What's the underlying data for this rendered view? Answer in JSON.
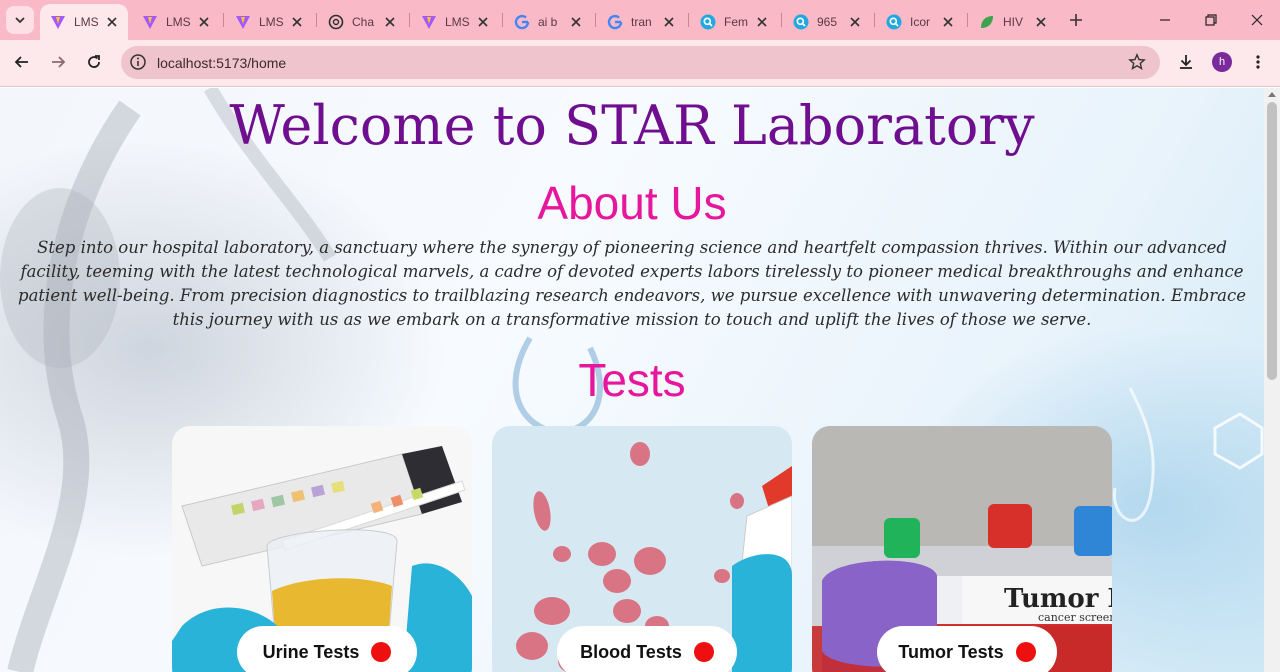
{
  "browser": {
    "tabs": [
      {
        "label": "LMS",
        "icon": "vite-icon",
        "active": true
      },
      {
        "label": "LMS",
        "icon": "vite-icon"
      },
      {
        "label": "LMS",
        "icon": "vite-icon"
      },
      {
        "label": "Cha",
        "icon": "chatgpt-icon"
      },
      {
        "label": "LMS",
        "icon": "vite-icon"
      },
      {
        "label": "ai b",
        "icon": "google-icon"
      },
      {
        "label": "tran",
        "icon": "google-icon"
      },
      {
        "label": "Fem",
        "icon": "search-bubble-icon"
      },
      {
        "label": "965",
        "icon": "search-bubble-icon"
      },
      {
        "label": "Icor",
        "icon": "search-bubble-icon"
      },
      {
        "label": "HIV",
        "icon": "leaf-icon"
      }
    ],
    "url": "localhost:5173/home",
    "profile_initial": "h"
  },
  "page": {
    "title": "Welcome to STAR Laboratory",
    "about_heading": "About Us",
    "about_text": "Step into our hospital laboratory, a sanctuary where the synergy of pioneering science and heartfelt compassion thrives. Within our advanced facility, teeming with the latest technological marvels, a cadre of devoted experts labors tirelessly to pioneer medical breakthroughs and enhance patient well-being. From precision diagnostics to trailblazing research endeavors, we pursue excellence with unwavering determination. Embrace this journey with us as we embark on a transformative mission to touch and uplift the lives of those we serve.",
    "tests_heading": "Tests",
    "cards": [
      {
        "label": "Urine Tests"
      },
      {
        "label": "Blood Tests"
      },
      {
        "label": "Tumor Tests",
        "image_text": "Tumor M",
        "image_subtext": "cancer screen"
      }
    ]
  },
  "colors": {
    "title": "#6f0f8f",
    "heading": "#e6169d",
    "dot": "#ee1010",
    "tabbar": "#f9b9c6"
  }
}
